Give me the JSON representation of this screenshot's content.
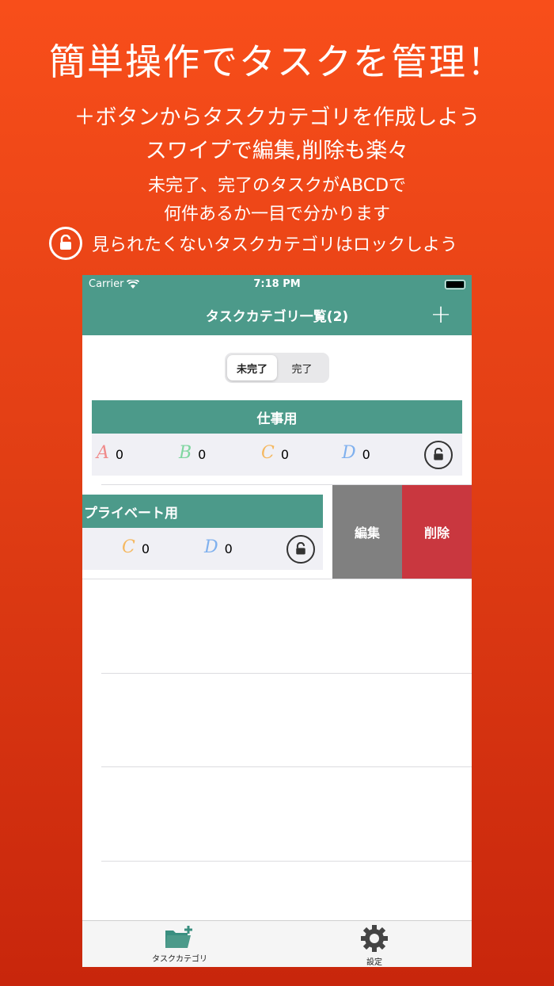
{
  "promo": {
    "title": "簡単操作でタスクを管理！",
    "line1": "＋ボタンからタスクカテゴリを作成しよう",
    "line2": "スワイプで編集,削除も楽々",
    "line3": "未完了、完了のタスクがABCDで",
    "line4": "何件あるか一目で分かります",
    "lock_line": "見られたくないタスクカテゴリはロックしよう"
  },
  "status_bar": {
    "carrier": "Carrier",
    "time": "7:18 PM"
  },
  "nav": {
    "title": "タスクカテゴリ一覧(2)",
    "add_label": "+"
  },
  "segments": {
    "incomplete": "未完了",
    "complete": "完了",
    "selected": "未完了"
  },
  "categories": [
    {
      "name": "仕事用",
      "counts": [
        {
          "grade": "A",
          "value": "0"
        },
        {
          "grade": "B",
          "value": "0"
        },
        {
          "grade": "C",
          "value": "0"
        },
        {
          "grade": "D",
          "value": "0"
        }
      ]
    },
    {
      "name": "プライベート用",
      "counts": [
        {
          "grade": "C",
          "value": "0"
        },
        {
          "grade": "D",
          "value": "0"
        }
      ]
    }
  ],
  "swipe_actions": {
    "edit": "編集",
    "delete": "削除"
  },
  "tabs": {
    "category": "タスクカテゴリ",
    "settings": "設定"
  },
  "colors": {
    "background": "#f84e1a",
    "accent": "#4c9a8a",
    "delete": "#c9373f",
    "edit": "#808080"
  }
}
